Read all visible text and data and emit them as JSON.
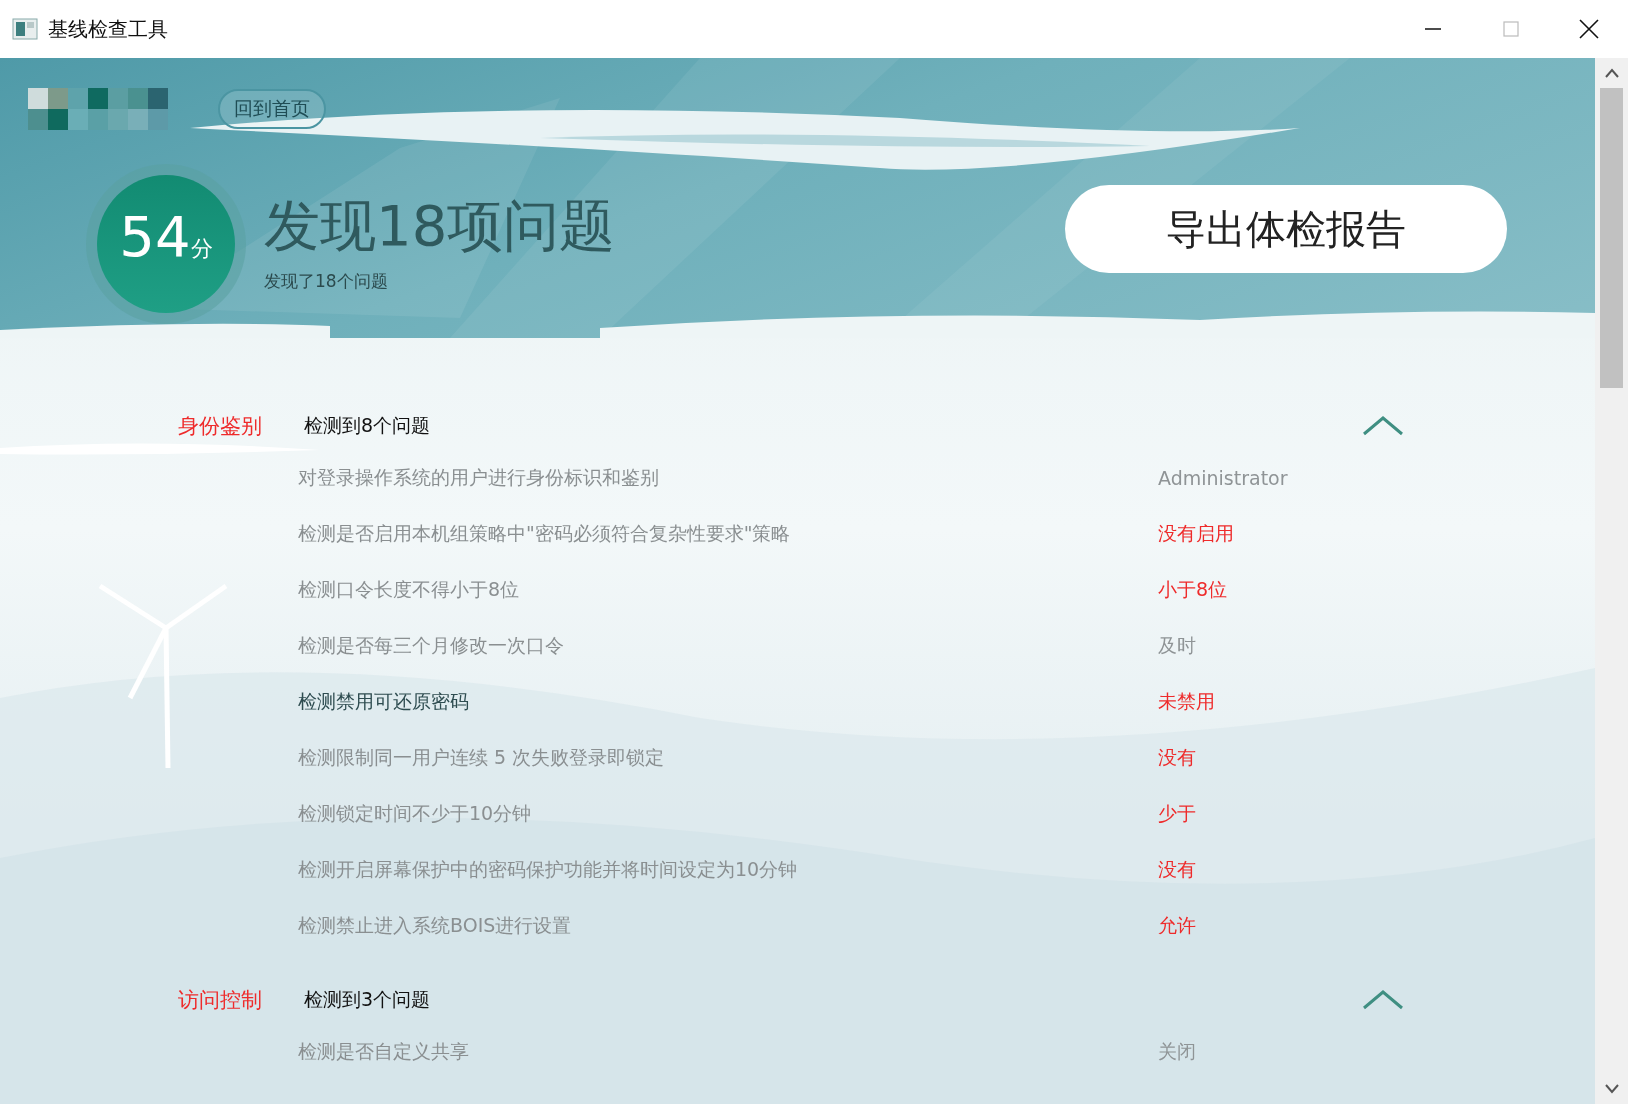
{
  "window": {
    "title": "基线检查工具"
  },
  "header": {
    "home_button": "回到首页",
    "score": "54",
    "score_unit": "分",
    "headline": "发现18项问题",
    "subline": "发现了18个问题",
    "export_button": "导出体检报告"
  },
  "sections": [
    {
      "name": "身份鉴别",
      "summary": "检测到8个问题",
      "expanded": true,
      "items": [
        {
          "label": "对登录操作系统的用户进行身份标识和鉴别",
          "result": "Administrator",
          "failed": false,
          "highlighted": false
        },
        {
          "label": "检测是否启用本机组策略中\"密码必须符合复杂性要求\"策略",
          "result": "没有启用",
          "failed": true,
          "highlighted": false
        },
        {
          "label": "检测口令长度不得小于8位",
          "result": "小于8位",
          "failed": true,
          "highlighted": false
        },
        {
          "label": "检测是否每三个月修改一次口令",
          "result": "及时",
          "failed": false,
          "highlighted": false
        },
        {
          "label": "检测禁用可还原密码",
          "result": "未禁用",
          "failed": true,
          "highlighted": true
        },
        {
          "label": "检测限制同一用户连续 5 次失败登录即锁定",
          "result": "没有",
          "failed": true,
          "highlighted": false
        },
        {
          "label": "检测锁定时间不少于10分钟",
          "result": "少于",
          "failed": true,
          "highlighted": false
        },
        {
          "label": "检测开启屏幕保护中的密码保护功能并将时间设定为10分钟",
          "result": "没有",
          "failed": true,
          "highlighted": false
        },
        {
          "label": "检测禁止进入系统BOIS进行设置",
          "result": "允许",
          "failed": true,
          "highlighted": false
        }
      ]
    },
    {
      "name": "访问控制",
      "summary": "检测到3个问题",
      "expanded": true,
      "items": [
        {
          "label": "检测是否自定义共享",
          "result": "关闭",
          "failed": false,
          "highlighted": false
        }
      ]
    }
  ]
}
